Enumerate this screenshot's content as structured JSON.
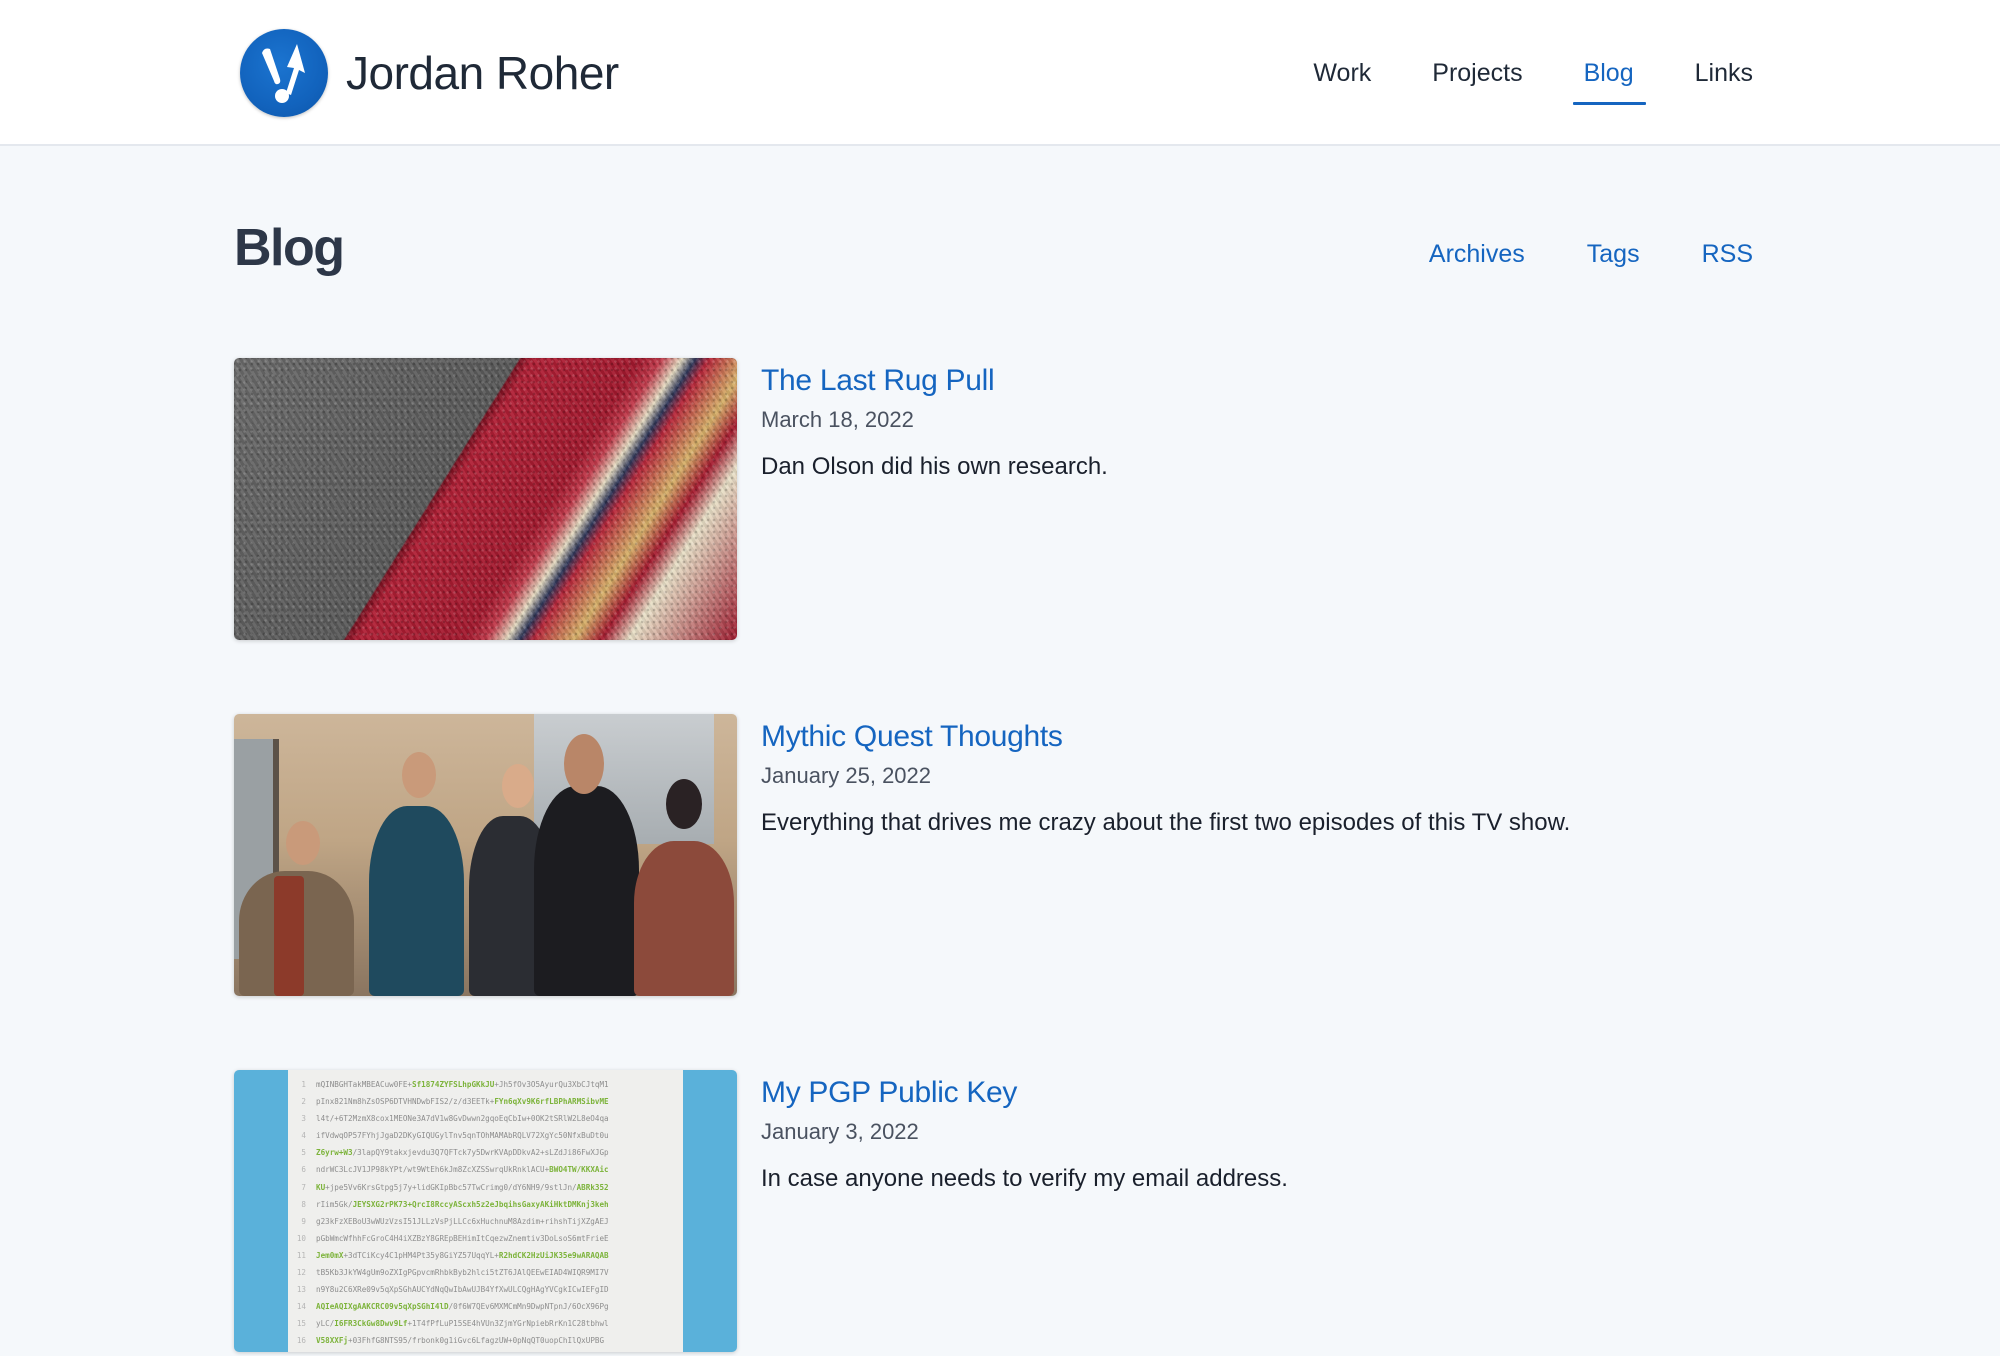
{
  "site": {
    "name": "Jordan Roher",
    "logo_icon": "exclamation-cursor-logo",
    "brand_color": "#1565c0"
  },
  "nav": {
    "items": [
      {
        "label": "Work",
        "active": false
      },
      {
        "label": "Projects",
        "active": false
      },
      {
        "label": "Blog",
        "active": true
      },
      {
        "label": "Links",
        "active": false
      }
    ]
  },
  "page": {
    "title": "Blog",
    "subnav": [
      {
        "label": "Archives"
      },
      {
        "label": "Tags"
      },
      {
        "label": "RSS"
      }
    ]
  },
  "posts": [
    {
      "title": "The Last Rug Pull",
      "date": "March 18, 2022",
      "excerpt": "Dan Olson did his own research.",
      "thumbnail": "rug-edge-on-carpet-photo"
    },
    {
      "title": "Mythic Quest Thoughts",
      "date": "January 25, 2022",
      "excerpt": "Everything that drives me crazy about the first two episodes of this TV show.",
      "thumbnail": "tv-show-cast-photo"
    },
    {
      "title": "My PGP Public Key",
      "date": "January 3, 2022",
      "excerpt": "In case anyone needs to verify my email address.",
      "thumbnail": "pgp-key-code-snippet",
      "code_lines": [
        {
          "n": "1",
          "parts": [
            [
              "mQINBGHTakMBEACuw0FE+",
              false
            ],
            [
              "Sf1874ZYFSLhpGKkJU",
              true
            ],
            [
              "+Jh5fOv3O5AyurQu3XbCJtqM1",
              false
            ]
          ]
        },
        {
          "n": "2",
          "parts": [
            [
              "pInx821Nm8hZsOSP6DTVHNDwbFIS2/z/d3EETk+",
              false
            ],
            [
              "FYn6qXv9K6rfLBPhARMSibvME",
              true
            ]
          ]
        },
        {
          "n": "3",
          "parts": [
            [
              "l4t/+6T2MzmX8cox1MEONe3A7dV1w8GvDwwn2gqoEqCbIw+0OK2tSRlW2L8eO4qa",
              false
            ]
          ]
        },
        {
          "n": "4",
          "parts": [
            [
              "ifVdwqOP57FYhjJgaD2DKyGIQUGylTnv5qnTOhMAMAbRQLV72XgYc50NfxBuDt0u",
              false
            ]
          ]
        },
        {
          "n": "5",
          "parts": [
            [
              "Z6yrw+W3",
              true
            ],
            [
              "/3lapQY9takxjevdu3Q7QFTck7y5DwrKVApDDkvA2+sLZdJi86FwXJGp",
              false
            ]
          ]
        },
        {
          "n": "6",
          "parts": [
            [
              "ndrWC3LcJV1JP98kYPt/wt9WtEh6kJm8ZcXZSSwrqUkRnklACU+",
              false
            ],
            [
              "BWO4TW/KKXAic",
              true
            ]
          ]
        },
        {
          "n": "7",
          "parts": [
            [
              "KU",
              true
            ],
            [
              "+jpe5Vv6KrsGtpg5j7y+lidGKIpBbc57TwCrimg0/dY6NH9/9stlJn/",
              false
            ],
            [
              "ABRk352",
              true
            ]
          ]
        },
        {
          "n": "8",
          "parts": [
            [
              "rIim5Gk/",
              false
            ],
            [
              "JEYSXG2rPK73+QrcI8RccyAScxh5z2eJbqihsGaxyAKiHktDMKnj3keh",
              true
            ]
          ]
        },
        {
          "n": "9",
          "parts": [
            [
              "g23kFzXEBoU3wWUzVzsI51JLLzVsPjLLCc6xHuchnuM8Azdim+rihshTijXZgAEJ",
              false
            ]
          ]
        },
        {
          "n": "10",
          "parts": [
            [
              "pGbWmcWfhhFcGroC4H4iXZBzY8GREpBEHimItCqezwZnemtiv3DoLsoS6mtFrieE",
              false
            ]
          ]
        },
        {
          "n": "11",
          "parts": [
            [
              "Jem0mX",
              true
            ],
            [
              "+3dTCiKcy4C1pHM4Pt35y8GiYZ57UqqYL+",
              false
            ],
            [
              "R2hdCK2HzUiJK35e9wARAQAB",
              true
            ]
          ]
        },
        {
          "n": "12",
          "parts": [
            [
              "tB5Kb3JkYW4gUm9oZXIgPGpvcmRhbkByb2hlci5tZT6JAlQEEwEIAD4WIQR9MI7V",
              false
            ]
          ]
        },
        {
          "n": "13",
          "parts": [
            [
              "n9Y8u2C6XRe09v5qXpSGhAUCYdNqQwIbAwUJB4YfXwULCQgHAgYVCgkICwIEFgID",
              false
            ]
          ]
        },
        {
          "n": "14",
          "parts": [
            [
              "AQIeAQIXgAAKCRC09v5qXpSGhI4lD",
              true
            ],
            [
              "/0f6W7QEv6MXMCmMn9DwpNTpnJ/6OcX96Pg",
              false
            ]
          ]
        },
        {
          "n": "15",
          "parts": [
            [
              "yLC/",
              false
            ],
            [
              "I6FR3CkGw8Dwv9Lf",
              true
            ],
            [
              "+1T4fPfLuP15SE4hVUn3ZjmYGrNpiebRrKn1C28tbhwl",
              false
            ]
          ]
        },
        {
          "n": "16",
          "parts": [
            [
              "V58XXFj",
              true
            ],
            [
              "+03FhfG8NTS95/frbonk0g1iGvc6LfagzUW+0pNqQT0uopChIlQxUPBG",
              false
            ]
          ]
        }
      ]
    }
  ]
}
